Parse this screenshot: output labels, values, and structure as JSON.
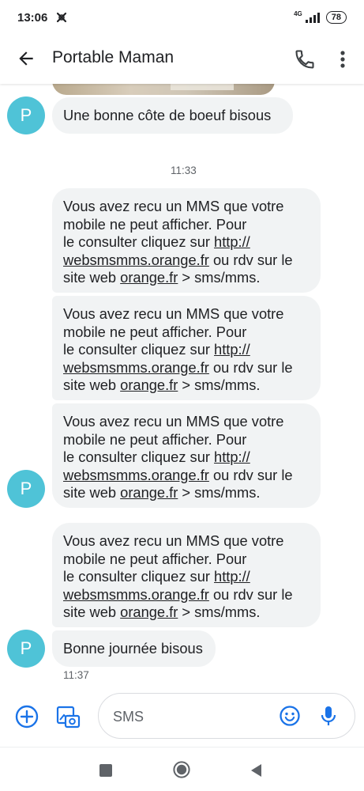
{
  "status": {
    "time": "13:06",
    "network": "4G",
    "battery": "78"
  },
  "appbar": {
    "title": "Portable Maman"
  },
  "contact": {
    "avatar_letter": "P",
    "avatar_color": "#4fc3d7"
  },
  "messages": {
    "m0": "Une bonne côte  de boeuf  bisous",
    "time_divider": "11:33",
    "mms": {
      "line1": "Vous avez recu un MMS que votre",
      "line2": "mobile ne peut afficher. Pour",
      "line3_prefix": "le consulter cliquez sur ",
      "link1_part1": "http://",
      "link1_part2": "websmsmms.orange.fr",
      "line4_middle": " ou rdv sur le",
      "line5_prefix": "site web ",
      "link2": "orange.fr",
      "line5_suffix": " > sms/mms."
    },
    "m_last": "Bonne journée bisous",
    "m_last_time": "11:37"
  },
  "composer": {
    "placeholder": "SMS"
  },
  "colors": {
    "accent": "#1a73e8",
    "bubble_incoming": "#f1f3f4",
    "avatar": "#4fc3d7"
  }
}
